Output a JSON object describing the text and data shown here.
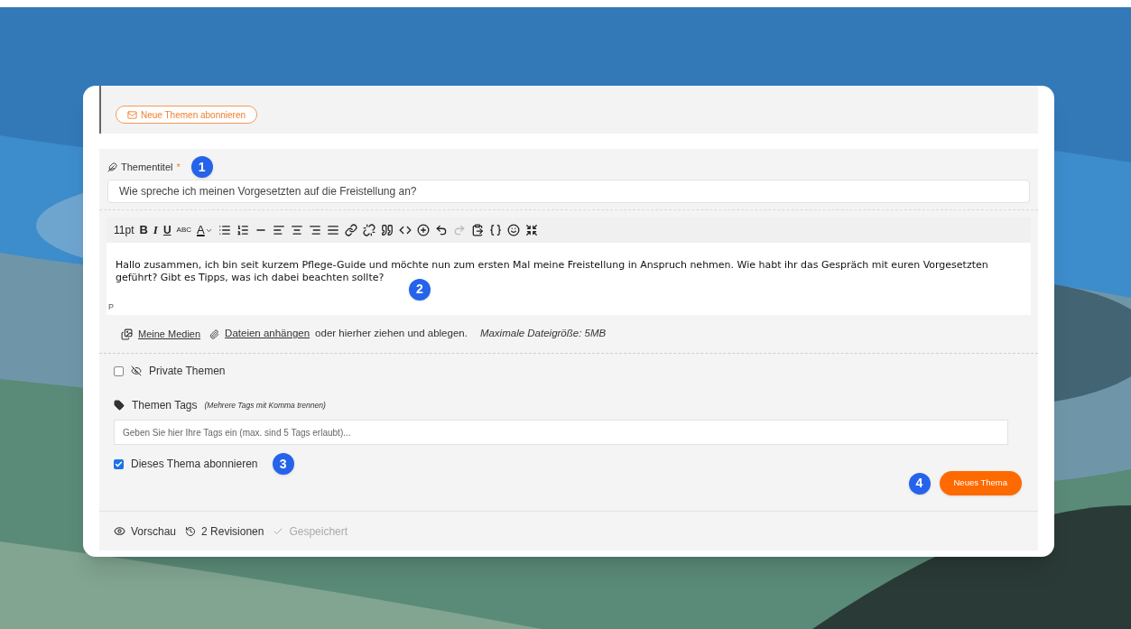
{
  "subscribe_topics_button": {
    "label": "Neue Themen abonnieren"
  },
  "title_field": {
    "label": "Thementitel",
    "required": "*",
    "marker": "1",
    "value": "Wie spreche ich meinen Vorgesetzten auf die Freistellung an?"
  },
  "editor": {
    "toolbar_text": [
      "11pt",
      "B",
      "I",
      "U",
      "ABC",
      "A"
    ],
    "redo_disabled": true,
    "text": "Hallo zusammen, ich bin seit kurzem Pflege-Guide und möchte nun zum ersten Mal meine Freistellung in Anspruch nehmen. Wie habt ihr das Gespräch mit euren Vorgesetzten geführt? Gibt es Tipps, was ich dabei beachten sollte?",
    "marker": "2",
    "path": "P"
  },
  "attachments": {
    "media_link": "Meine Medien",
    "attach_link": "Dateien anhängen",
    "hint": "oder hierher ziehen und ablegen.",
    "max_size": "Maximale Dateigröße: 5MB"
  },
  "private_topic": {
    "label": "Private Themen",
    "checked": false
  },
  "tags": {
    "label": "Themen Tags",
    "hint": "(Mehrere Tags mit Komma trennen)",
    "placeholder": "Geben Sie hier Ihre Tags ein (max. sind 5 Tags erlaubt)..."
  },
  "subscribe_topic": {
    "label": "Dieses Thema abonnieren",
    "checked": true,
    "marker": "3"
  },
  "submit": {
    "label": "Neues Thema",
    "marker": "4"
  },
  "footer": {
    "preview": "Vorschau",
    "revisions": "2 Revisionen",
    "saved": "Gespeichert"
  }
}
